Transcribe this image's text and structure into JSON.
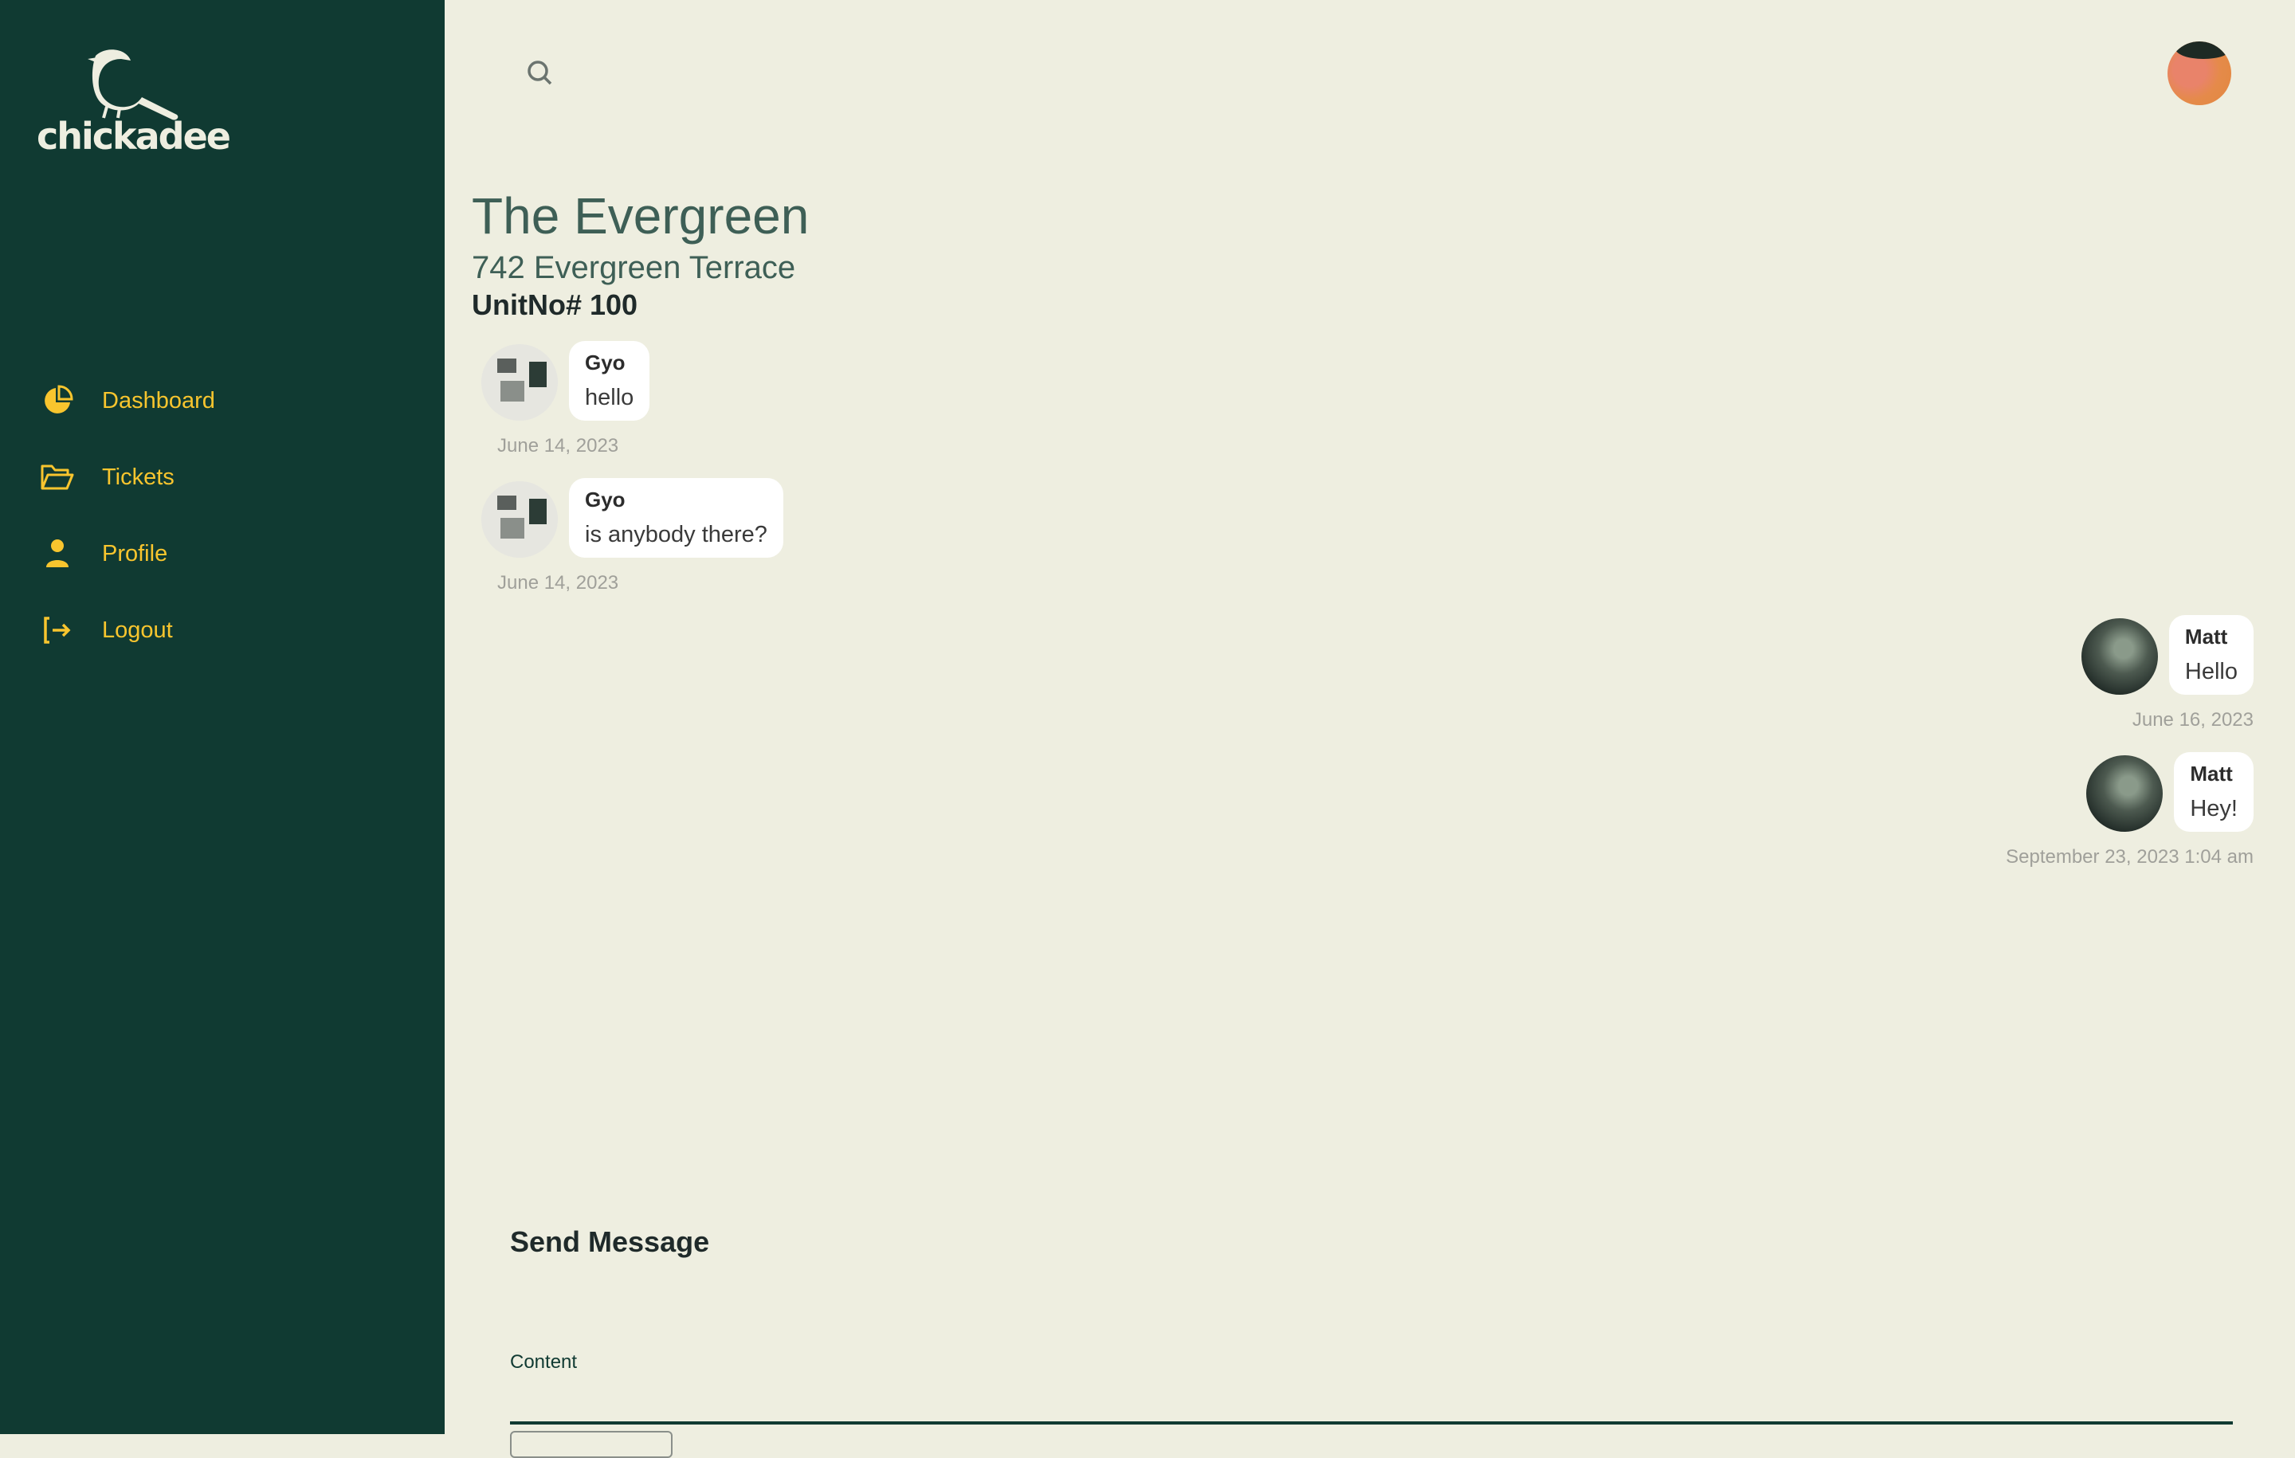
{
  "brand": {
    "name": "chickadee"
  },
  "sidebar": {
    "items": [
      {
        "label": "Dashboard",
        "icon": "pie-chart-icon"
      },
      {
        "label": "Tickets",
        "icon": "folder-open-icon"
      },
      {
        "label": "Profile",
        "icon": "user-icon"
      },
      {
        "label": "Logout",
        "icon": "logout-icon"
      }
    ]
  },
  "header": {
    "search_icon": "search-icon",
    "avatar": "user-avatar"
  },
  "property": {
    "name": "The Evergreen",
    "address": "742 Evergreen Terrace",
    "unit": "UnitNo# 100"
  },
  "messages": [
    {
      "author": "Gyo",
      "text": "hello",
      "timestamp": "June 14, 2023",
      "side": "left"
    },
    {
      "author": "Gyo",
      "text": "is anybody there?",
      "timestamp": "June 14, 2023",
      "side": "left"
    },
    {
      "author": "Matt",
      "text": "Hello",
      "timestamp": "June 16, 2023",
      "side": "right"
    },
    {
      "author": "Matt",
      "text": "Hey!",
      "timestamp": "September 23, 2023 1:04 am",
      "side": "right"
    }
  ],
  "send_form": {
    "title": "Send Message",
    "content_label": "Content",
    "content_value": "",
    "content_placeholder": ""
  },
  "colors": {
    "sidebar": "#103a32",
    "accent": "#f8c52e",
    "background": "#eeeee0"
  }
}
